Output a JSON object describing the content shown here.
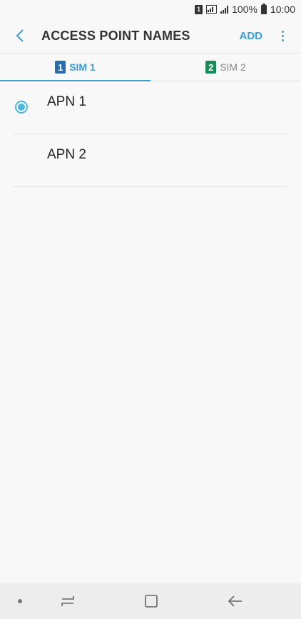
{
  "status_bar": {
    "sim_label": "1",
    "battery": "100%",
    "time": "10:00"
  },
  "app_bar": {
    "title": "ACCESS POINT NAMES",
    "add_label": "ADD"
  },
  "tabs": [
    {
      "badge": "1",
      "label": "SIM 1",
      "active": true
    },
    {
      "badge": "2",
      "label": "SIM 2",
      "active": false
    }
  ],
  "apn_list": [
    {
      "name": "APN 1",
      "selected": true
    },
    {
      "name": "APN 2",
      "selected": false
    }
  ],
  "colors": {
    "accent": "#3b9ed4",
    "radio": "#4bb7e3",
    "sim1": "#2a6bb0",
    "sim2": "#1a8a5a"
  },
  "nav_icons": [
    "dot-indicator",
    "recent-apps-icon",
    "home-icon",
    "back-icon"
  ]
}
